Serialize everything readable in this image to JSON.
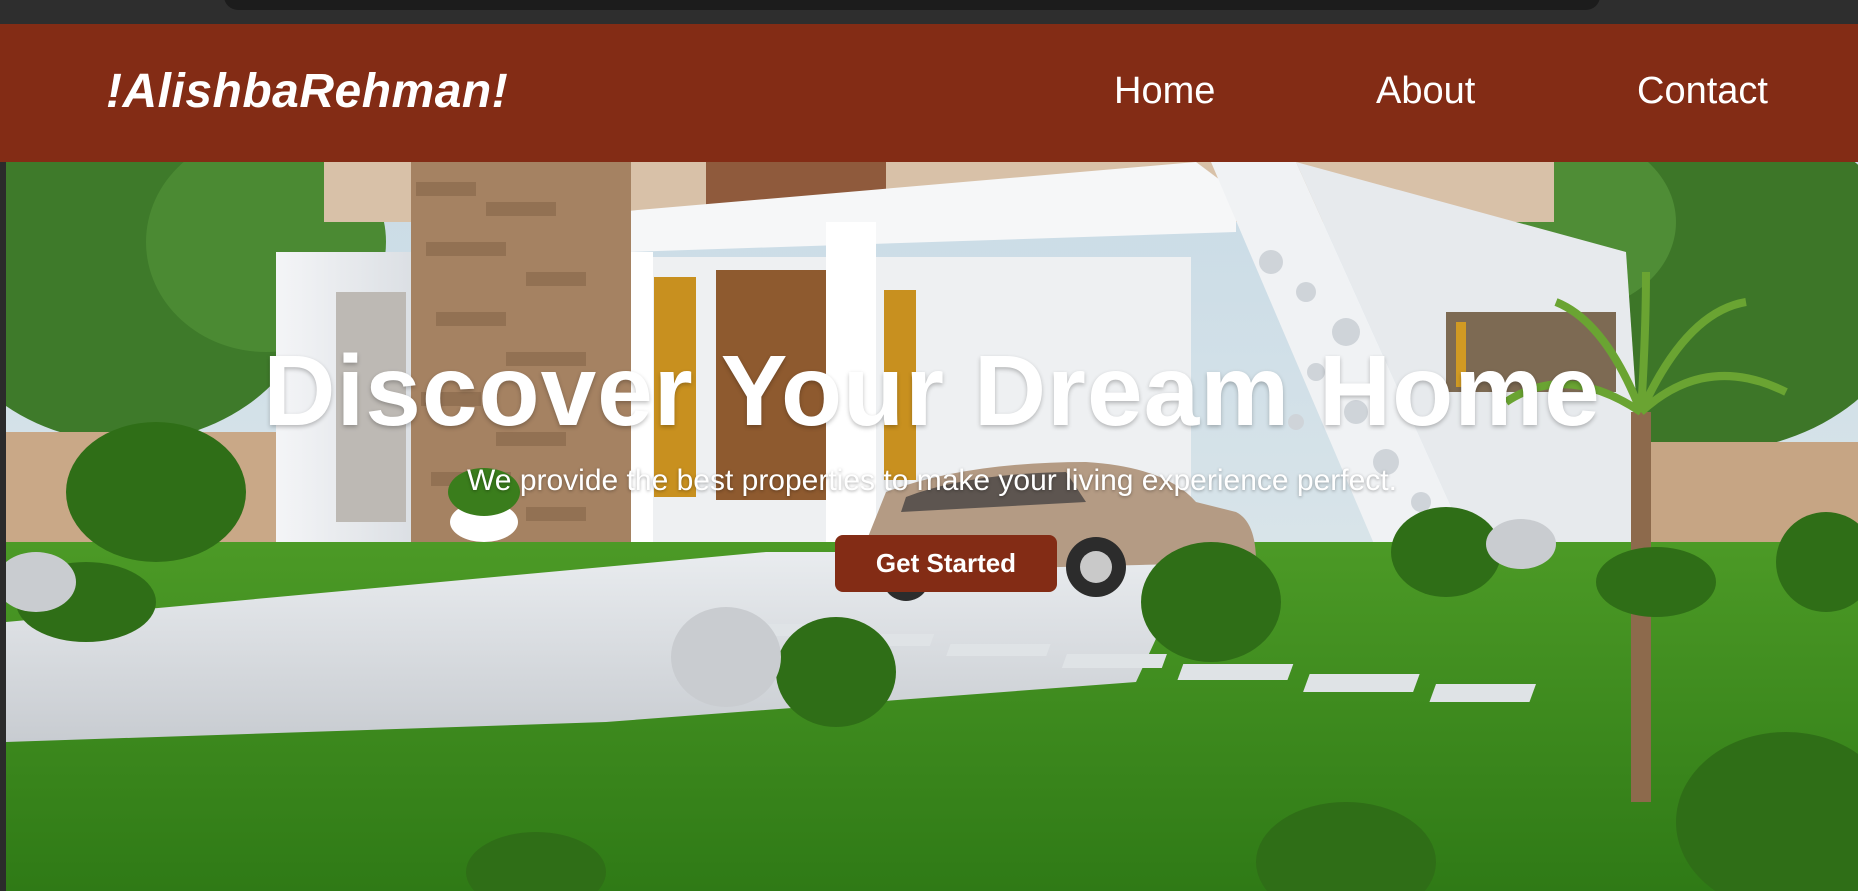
{
  "brand": {
    "logo_text": "!AlishbaRehman!"
  },
  "nav": {
    "items": [
      {
        "label": "Home"
      },
      {
        "label": "About"
      },
      {
        "label": "Contact"
      }
    ]
  },
  "hero": {
    "title": "Discover Your Dream Home",
    "subtitle": "We provide the best properties to make your living experience perfect.",
    "cta_label": "Get Started",
    "background_image": "modern-house-with-car-and-garden"
  },
  "colors": {
    "navbar": "#832c15",
    "button": "#832c15",
    "text": "#ffffff",
    "browser_chrome": "#2e2e2e"
  }
}
